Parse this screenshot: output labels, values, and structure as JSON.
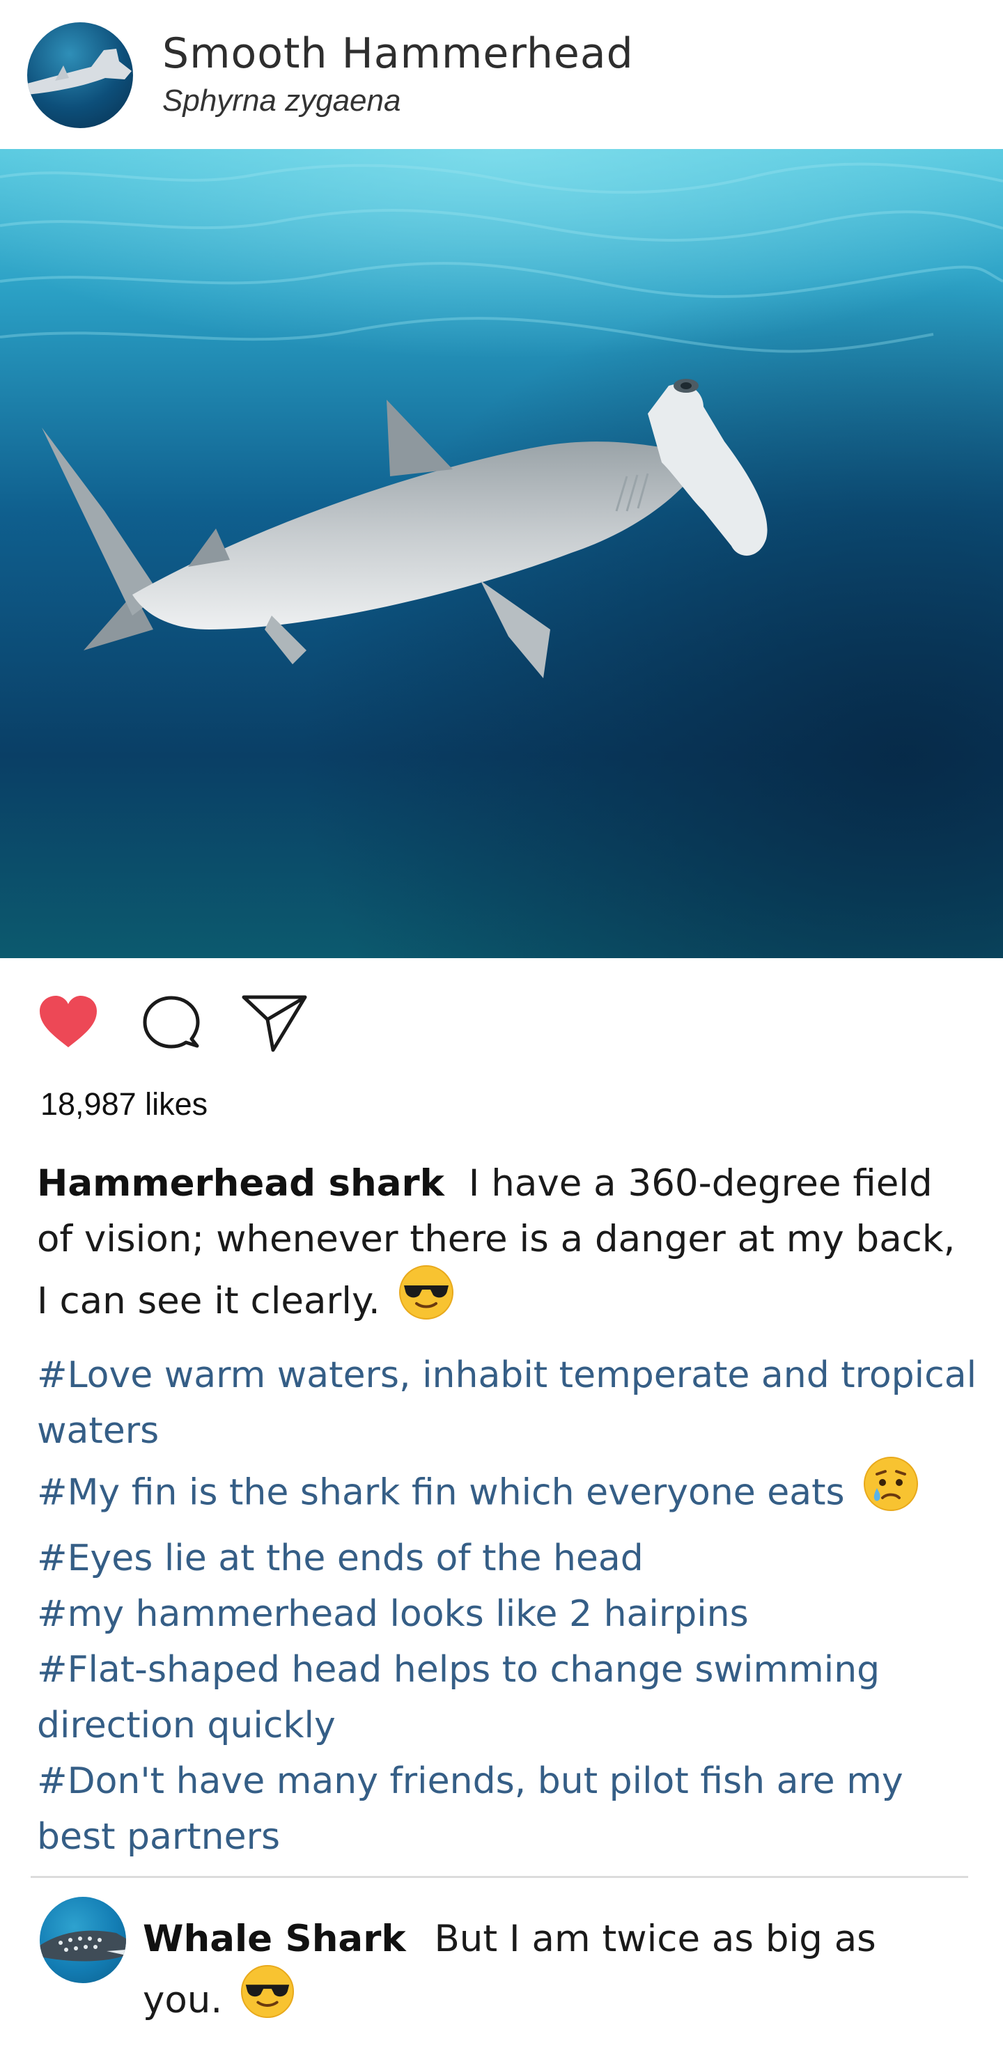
{
  "post": {
    "title": "Smooth Hammerhead",
    "subtitle": "Sphyrna zygaena",
    "likes": "18,987 likes",
    "caption_author": "Hammerhead shark",
    "caption_text": "I have a 360-degree field of vision; whenever there is a danger at my back, I can see it clearly.",
    "caption_emoji": "sunglasses-emoji",
    "hashtags": [
      {
        "text": "#Love warm waters, inhabit temperate and tropical waters",
        "emoji": ""
      },
      {
        "text": "#My fin is the shark fin which everyone eats",
        "emoji": "crying-emoji"
      },
      {
        "text": "#Eyes lie at the ends of the head",
        "emoji": ""
      },
      {
        "text": "#my hammerhead looks like 2 hairpins",
        "emoji": ""
      },
      {
        "text": "#Flat-shaped  head helps to change swimming direction quickly",
        "emoji": ""
      },
      {
        "text": "#Don't have many friends, but pilot fish are my best partners",
        "emoji": ""
      }
    ]
  },
  "actions": {
    "like_icon": "heart-filled-icon",
    "comment_icon": "speech-bubble-icon",
    "share_icon": "paper-plane-icon",
    "like_color": "#ed4856"
  },
  "comment": {
    "author": "Whale Shark",
    "text": "But I am twice as big as you.",
    "emoji": "sunglasses-emoji"
  },
  "colors": {
    "hashtag": "#355e86",
    "water_top": "#4fc4dc",
    "water_bottom": "#0b3d5e"
  }
}
